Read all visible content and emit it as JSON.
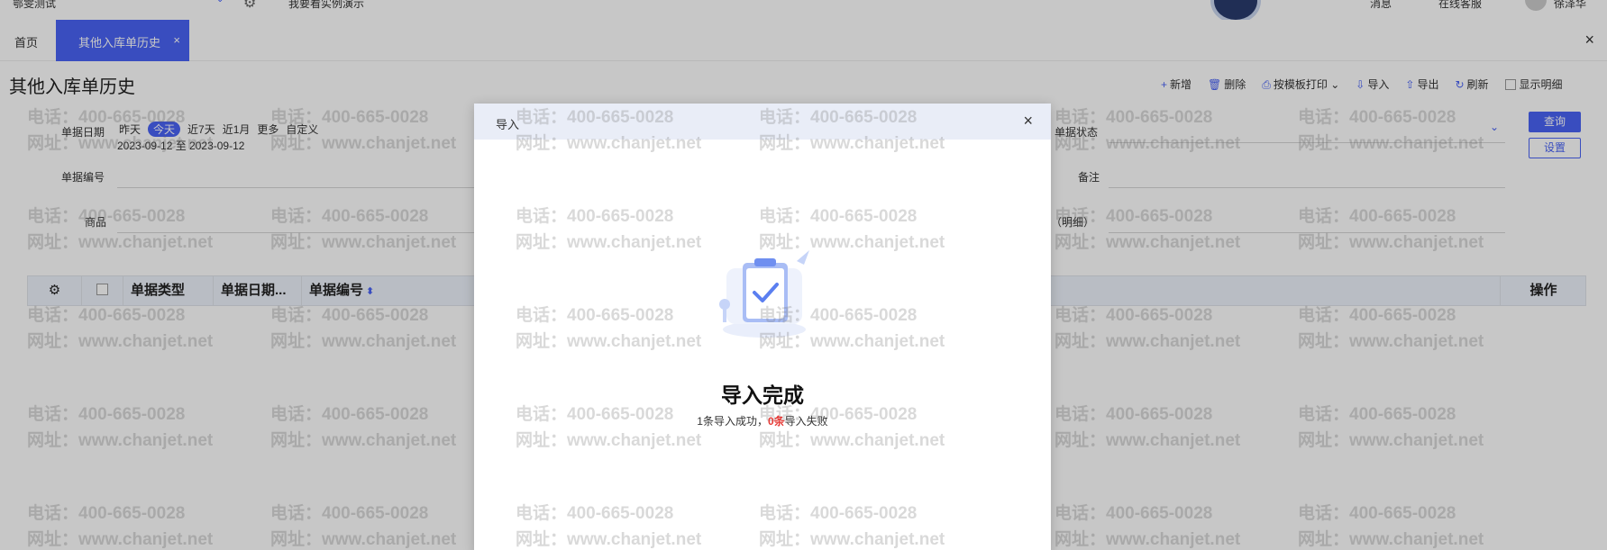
{
  "topbar": {
    "account": "鄂雯测试",
    "demo_label": "我要看实例演示",
    "messages_label": "消息",
    "service_label": "在线客服",
    "user_name": "徐泽华"
  },
  "tabs": {
    "home": "首页",
    "active": "其他入库单历史",
    "active_close": "×",
    "close_all": "×"
  },
  "page": {
    "title": "其他入库单历史",
    "toolbar": {
      "add": "新增",
      "delete": "删除",
      "print": "按模板打印",
      "import": "导入",
      "export": "导出",
      "refresh": "刷新",
      "show_detail": "显示明细"
    }
  },
  "filters": {
    "date_label": "单据日期",
    "date_chips": [
      "昨天",
      "今天",
      "近7天",
      "近1月",
      "更多",
      "自定义"
    ],
    "date_range": "2023-09-12 至 2023-09-12",
    "number_label": "单据编号",
    "product_label": "商品",
    "status_label": "单据状态",
    "remark_label": "备注",
    "detail_label": "（明细）",
    "query_button": "查询",
    "settings_button": "设置"
  },
  "table": {
    "columns": [
      "单据类型",
      "单据日期...",
      "单据编号"
    ],
    "action_column": "操作"
  },
  "watermark": {
    "phone": "电话：400-665-0028",
    "site": "网址：www.chanjet.net"
  },
  "modal": {
    "title": "导入",
    "close": "×",
    "result_title": "导入完成",
    "success_text": "1条导入成功，",
    "fail_count": "0条",
    "fail_text": "导入失败"
  },
  "colors": {
    "primary": "#4a63f5",
    "fail": "#e53935"
  }
}
